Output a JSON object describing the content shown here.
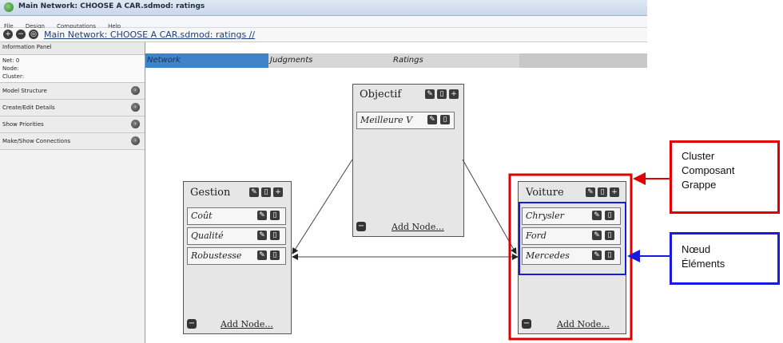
{
  "window": {
    "title": "Main Network: CHOOSE A CAR.sdmod: ratings"
  },
  "menu": [
    "File",
    "Design",
    "Computations",
    "Help"
  ],
  "path": {
    "label": "Main Network: CHOOSE A CAR.sdmod: ratings //"
  },
  "panel": {
    "title": "Information Panel",
    "net": "Net: 0",
    "node": "Node:",
    "cluster": "Cluster:",
    "sections": [
      "Model Structure",
      "Create/Edit Details",
      "Show Priorities",
      "Make/Show Connections"
    ]
  },
  "tabs": [
    "Network",
    "Judgments",
    "Ratings"
  ],
  "clusters": {
    "objectif": {
      "name": "Objectif",
      "nodes": [
        "Meilleure V"
      ],
      "add": "Add Node..."
    },
    "gestion": {
      "name": "Gestion",
      "nodes": [
        "Coût",
        "Qualité",
        "Robustesse"
      ],
      "add": "Add Node..."
    },
    "voiture": {
      "name": "Voiture",
      "nodes": [
        "Chrysler",
        "Ford",
        "Mercedes"
      ],
      "add": "Add Node..."
    }
  },
  "annotations": {
    "cluster": [
      "Cluster",
      "Composant",
      "Grappe"
    ],
    "node": [
      "Nœud",
      "Éléments"
    ]
  },
  "colors": {
    "tab_active": "#3f83c9",
    "cluster_annotation": "#e00000",
    "node_annotation": "#1a1adf"
  }
}
